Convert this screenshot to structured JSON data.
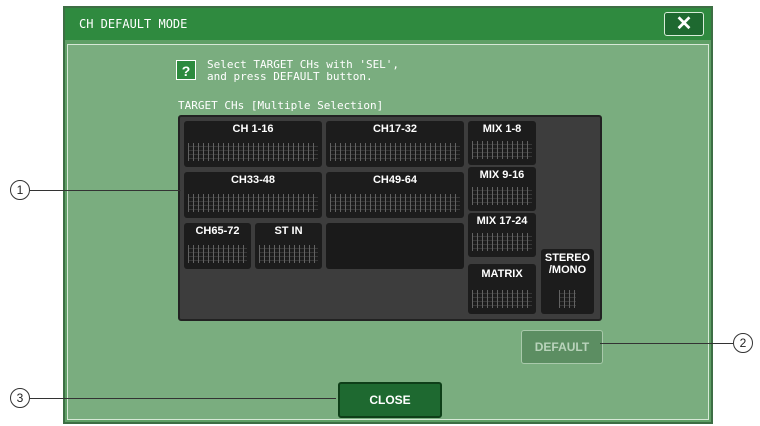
{
  "dialog": {
    "title": "CH DEFAULT MODE",
    "close_x": "✕",
    "help_glyph": "?",
    "instruction_line1": "Select TARGET CHs with 'SEL',",
    "instruction_line2": "and press DEFAULT button.",
    "target_label": "TARGET CHs [Multiple Selection]",
    "groups": [
      {
        "label": "CH 1-16"
      },
      {
        "label": "CH17-32"
      },
      {
        "label": "CH33-48"
      },
      {
        "label": "CH49-64"
      },
      {
        "label": "CH65-72"
      },
      {
        "label": "ST IN"
      },
      {
        "label": "MIX 1-8"
      },
      {
        "label": "MIX 9-16"
      },
      {
        "label": "MIX 17-24"
      },
      {
        "label": "MATRIX"
      },
      {
        "label_line1": "STEREO",
        "label_line2": "/MONO"
      }
    ],
    "default_label": "DEFAULT",
    "close_label": "CLOSE"
  },
  "callouts": [
    "1",
    "2",
    "3"
  ]
}
